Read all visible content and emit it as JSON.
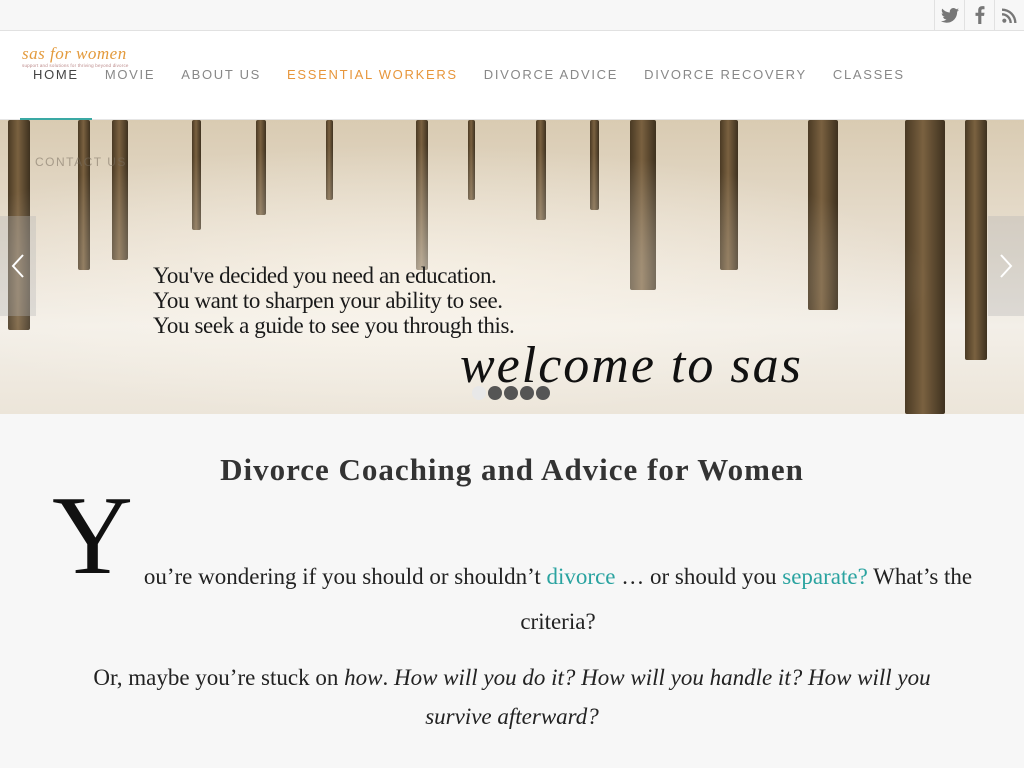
{
  "social": [
    {
      "name": "twitter-icon"
    },
    {
      "name": "facebook-icon"
    },
    {
      "name": "rss-icon"
    }
  ],
  "logo": {
    "text": "sas for women",
    "tagline": "support and solutions for thriving beyond divorce"
  },
  "nav": {
    "items": [
      {
        "label": "HOME"
      },
      {
        "label": "MOVIE"
      },
      {
        "label": "ABOUT US"
      },
      {
        "label": "ESSENTIAL WORKERS"
      },
      {
        "label": "DIVORCE ADVICE"
      },
      {
        "label": "DIVORCE RECOVERY"
      },
      {
        "label": "CLASSES"
      }
    ],
    "overflow_item": "CONTACT US",
    "active_color": "#3aa9a4",
    "highlight_color": "#e7963b"
  },
  "hero": {
    "lines": [
      "You've decided you need an education.",
      "You want to sharpen your ability to see.",
      "You seek a guide to see you through this."
    ],
    "script": "welcome to sas",
    "slide_count": 5,
    "current_slide": 1
  },
  "content": {
    "title": "Divorce Coaching and Advice for Women",
    "dropcap": "Y",
    "para1_start": "ou’re wondering if you should or shouldn’t ",
    "link1": "divorce",
    "para1_mid": " … or should you ",
    "link2": "separate?",
    "para1_end": "  What’s the criteria?",
    "para2_start": "Or, maybe you’re stuck on ",
    "para2_italic": "how",
    "para2_rest_prefix": ". ",
    "para2_italic2": "How will you do it? How will you handle it? How will you survive afterward?",
    "link_color": "#2aa3a0"
  }
}
